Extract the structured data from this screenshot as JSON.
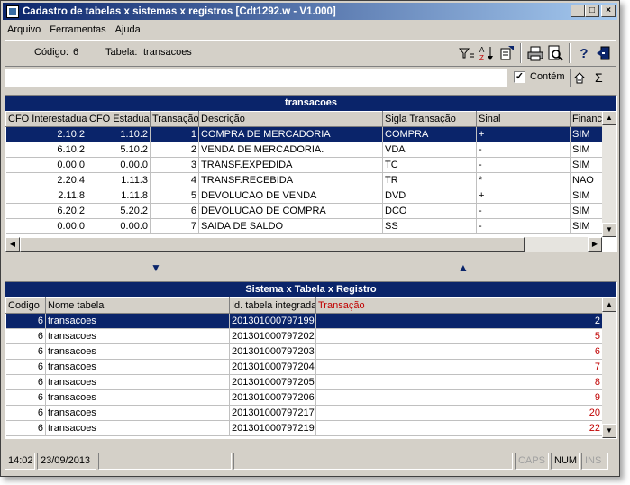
{
  "window": {
    "title": "Cadastro de tabelas x sistemas x registros [Cdt1292.w - V1.000]"
  },
  "menu": [
    "Arquivo",
    "Ferramentas",
    "Ajuda"
  ],
  "toolbar": {
    "codigo_label": "Código:",
    "codigo_value": "6",
    "tabela_label": "Tabela:",
    "tabela_value": "transacoes"
  },
  "search": {
    "value": "",
    "contem_label": "Contém",
    "contem_checked": "✓"
  },
  "top_grid": {
    "title": "transacoes",
    "columns": [
      "CFO Interestadual",
      "CFO Estadual",
      "Transação",
      "Descrição",
      "Sigla Transação",
      "Sinal",
      "Financeiro"
    ],
    "rows": [
      [
        "2.10.2",
        "1.10.2",
        "1",
        "COMPRA DE MERCADORIA",
        "COMPRA",
        "+",
        "SIM"
      ],
      [
        "6.10.2",
        "5.10.2",
        "2",
        "VENDA DE MERCADORIA.",
        "VDA",
        "-",
        "SIM"
      ],
      [
        "0.00.0",
        "0.00.0",
        "3",
        "TRANSF.EXPEDIDA",
        "TC",
        "-",
        "SIM"
      ],
      [
        "2.20.4",
        "1.11.3",
        "4",
        "TRANSF.RECEBIDA",
        "TR",
        "*",
        "NAO"
      ],
      [
        "2.11.8",
        "1.11.8",
        "5",
        "DEVOLUCAO DE VENDA",
        "DVD",
        "+",
        "SIM"
      ],
      [
        "6.20.2",
        "5.20.2",
        "6",
        "DEVOLUCAO DE COMPRA",
        "DCO",
        "-",
        "SIM"
      ],
      [
        "0.00.0",
        "0.00.0",
        "7",
        "SAIDA DE SALDO",
        "SS",
        "-",
        "SIM"
      ]
    ]
  },
  "bottom_grid": {
    "title": "Sistema x Tabela x Registro",
    "columns": [
      "Codigo",
      "Nome tabela",
      "Id. tabela integrada",
      "Transação"
    ],
    "rows": [
      [
        "6",
        "transacoes",
        "201301000797199",
        "2"
      ],
      [
        "6",
        "transacoes",
        "201301000797202",
        "5"
      ],
      [
        "6",
        "transacoes",
        "201301000797203",
        "6"
      ],
      [
        "6",
        "transacoes",
        "201301000797204",
        "7"
      ],
      [
        "6",
        "transacoes",
        "201301000797205",
        "8"
      ],
      [
        "6",
        "transacoes",
        "201301000797206",
        "9"
      ],
      [
        "6",
        "transacoes",
        "201301000797217",
        "20"
      ],
      [
        "6",
        "transacoes",
        "201301000797219",
        "22"
      ]
    ]
  },
  "status": {
    "time": "14:02",
    "date": "23/09/2013",
    "caps": "CAPS",
    "num": "NUM",
    "ins": "INS"
  },
  "colors": {
    "title_start": "#0a246a",
    "title_end": "#a6caf0",
    "selection": "#0a246a",
    "transacao_red": "#c00000"
  }
}
